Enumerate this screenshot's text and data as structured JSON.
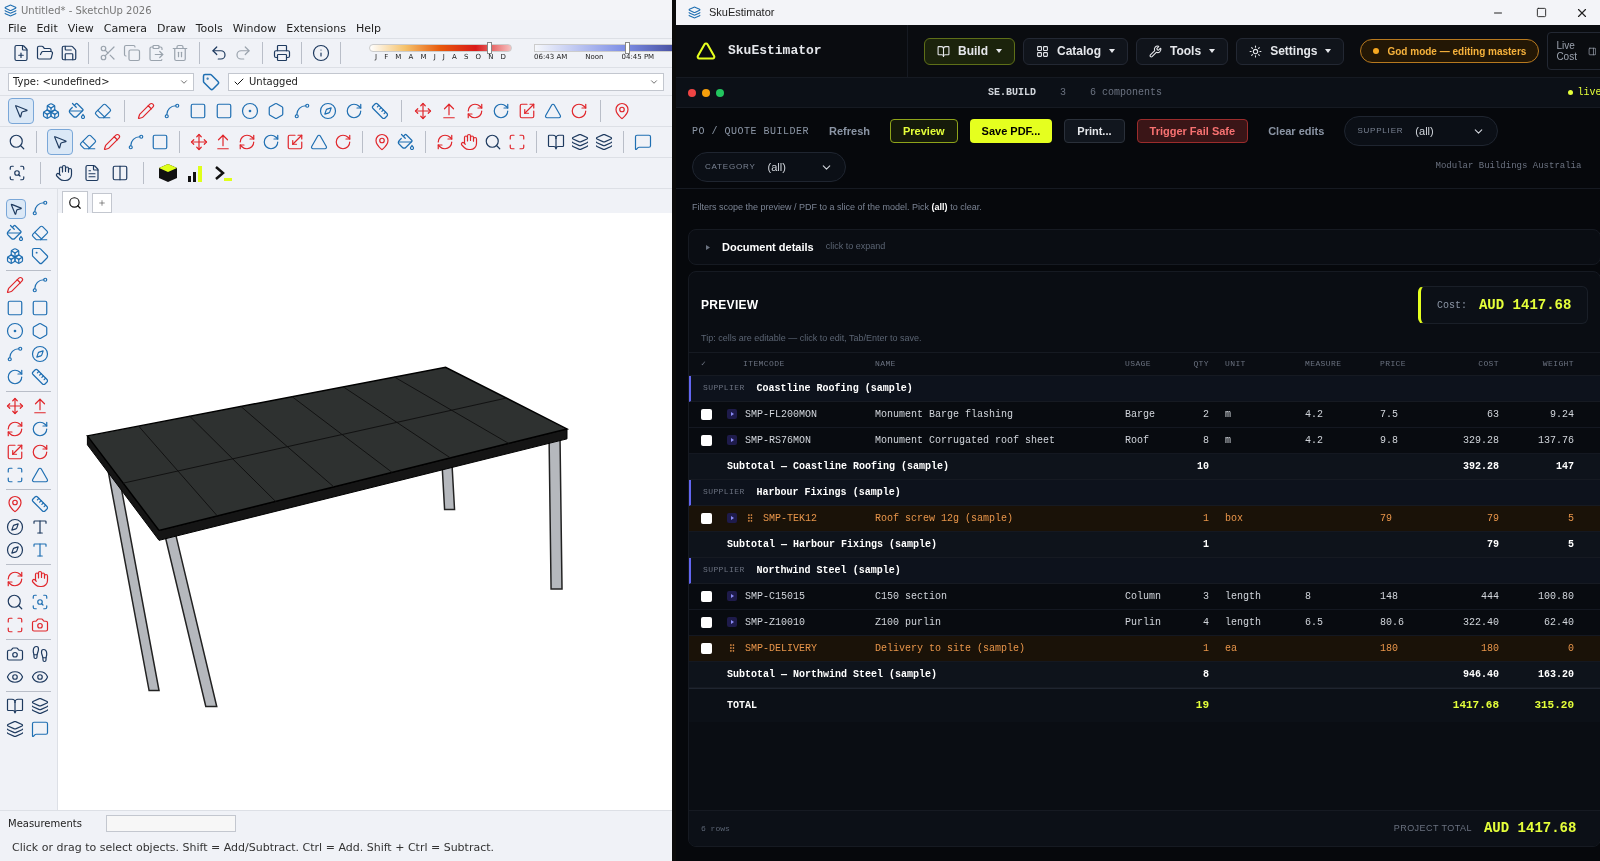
{
  "sketchup": {
    "title": "Untitled* - SketchUp 2026",
    "menu": [
      "File",
      "Edit",
      "View",
      "Camera",
      "Draw",
      "Tools",
      "Window",
      "Extensions",
      "Help"
    ],
    "month_slider": {
      "labels": [
        "J",
        "F",
        "M",
        "A",
        "M",
        "J",
        "J",
        "A",
        "S",
        "O",
        "N",
        "D"
      ],
      "level": 0.85
    },
    "time_slider": {
      "labels": [
        "06:43 AM",
        "Noon",
        "04:45 PM"
      ],
      "level": 0.52
    },
    "type_select": {
      "value": "Type: <undefined>"
    },
    "tag_select": {
      "value": "Untagged",
      "checked": true
    },
    "select_tool": {
      "selected": true
    },
    "measurements": {
      "label": "Measurements"
    },
    "status": "Click or drag to select objects. Shift = Add/Subtract. Ctrl = Add. Shift + Ctrl = Subtract."
  },
  "estimator": {
    "window_title": "SkuEstimator",
    "brand": "SkuEstimator",
    "nav": [
      {
        "label": "Build",
        "selected": true
      },
      {
        "label": "Catalog",
        "selected": false
      },
      {
        "label": "Tools",
        "selected": false
      },
      {
        "label": "Settings",
        "selected": false
      }
    ],
    "mode_badge": "God mode — editing masters",
    "live_cost_button": "Live Cost",
    "module": {
      "name": "SE.BUILD",
      "count": "3",
      "components": "6 components",
      "status": "live"
    },
    "toolbar": {
      "title": "PO / QUOTE BUILDER",
      "buttons": [
        {
          "label": "Refresh",
          "kind": "ghost"
        },
        {
          "label": "Preview",
          "kind": "outline"
        },
        {
          "label": "Save PDF...",
          "kind": "primary"
        },
        {
          "label": "Print...",
          "kind": "default"
        },
        {
          "label": "Trigger Fail Safe",
          "kind": "danger"
        },
        {
          "label": "Clear edits",
          "kind": "ghost"
        }
      ]
    },
    "supplier_filter": {
      "label": "SUPPLIER",
      "value": "(all)"
    },
    "category_filter": {
      "label": "CATEGORY",
      "value": "(all)"
    },
    "company": "Modular Buildings Australia",
    "hint": "Filters scope the preview / PDF to a slice of the model. Pick **(all)** to clear.",
    "document_details": {
      "title": "Document details",
      "hint": "click to expand",
      "expanded": false
    },
    "preview": {
      "title": "PREVIEW",
      "cost_label": "Cost:",
      "cost_value": "AUD 1417.68",
      "tip": "Tip: cells are editable — click to edit, Tab/Enter to save.",
      "columns": [
        "✓",
        "ITEMCODE",
        "NAME",
        "USAGE",
        "QTY",
        "UNIT",
        "MEASURE",
        "PRICE",
        "COST",
        "WEIGHT"
      ],
      "groups": [
        {
          "label": "SUPPLIER",
          "name": "Coastline Roofing (sample)",
          "rows": [
            {
              "checked": false,
              "expandable": true,
              "custom": false,
              "itemcode": "SMP-FL200MON",
              "name": "Monument Barge flashing",
              "usage": "Barge",
              "qty": "2",
              "unit": "m",
              "measure": "4.2",
              "price": "7.5",
              "cost": "63",
              "weight": "9.24"
            },
            {
              "checked": false,
              "expandable": true,
              "custom": false,
              "itemcode": "SMP-RS76MON",
              "name": "Monument Corrugated roof sheet",
              "usage": "Roof",
              "qty": "8",
              "unit": "m",
              "measure": "4.2",
              "price": "9.8",
              "cost": "329.28",
              "weight": "137.76"
            }
          ],
          "subtotal": {
            "label": "Subtotal — Coastline Roofing (sample)",
            "qty": "10",
            "cost": "392.28",
            "weight": "147"
          }
        },
        {
          "label": "SUPPLIER",
          "name": "Harbour Fixings (sample)",
          "rows": [
            {
              "checked": false,
              "expandable": true,
              "custom": true,
              "itemcode": "SMP-TEK12",
              "name": "Roof screw 12g (sample)",
              "qty": "1",
              "unit": "box",
              "price": "79",
              "cost": "79",
              "weight": "5"
            }
          ],
          "subtotal": {
            "label": "Subtotal — Harbour Fixings (sample)",
            "qty": "1",
            "cost": "79",
            "weight": "5"
          }
        },
        {
          "label": "SUPPLIER",
          "name": "Northwind Steel (sample)",
          "rows": [
            {
              "checked": false,
              "expandable": true,
              "custom": false,
              "itemcode": "SMP-C15015",
              "name": "C150 section",
              "usage": "Column",
              "qty": "3",
              "unit": "length",
              "measure": "8",
              "price": "148",
              "cost": "444",
              "weight": "100.80"
            },
            {
              "checked": false,
              "expandable": true,
              "custom": false,
              "itemcode": "SMP-Z10010",
              "name": "Z100 purlin",
              "usage": "Purlin",
              "qty": "4",
              "unit": "length",
              "measure": "6.5",
              "price": "80.6",
              "cost": "322.40",
              "weight": "62.40"
            },
            {
              "checked": false,
              "expandable": false,
              "custom": true,
              "itemcode": "SMP-DELIVERY",
              "name": "Delivery to site (sample)",
              "qty": "1",
              "unit": "ea",
              "price": "180",
              "cost": "180",
              "weight": "0"
            }
          ],
          "subtotal": {
            "label": "Subtotal — Northwind Steel (sample)",
            "qty": "8",
            "cost": "946.40",
            "weight": "163.20"
          }
        }
      ],
      "total": {
        "label": "TOTAL",
        "qty": "19",
        "cost": "1417.68",
        "weight": "315.20"
      },
      "footer": {
        "rows": "6 rows",
        "label": "PROJECT TOTAL",
        "value": "AUD 1417.68"
      }
    }
  }
}
